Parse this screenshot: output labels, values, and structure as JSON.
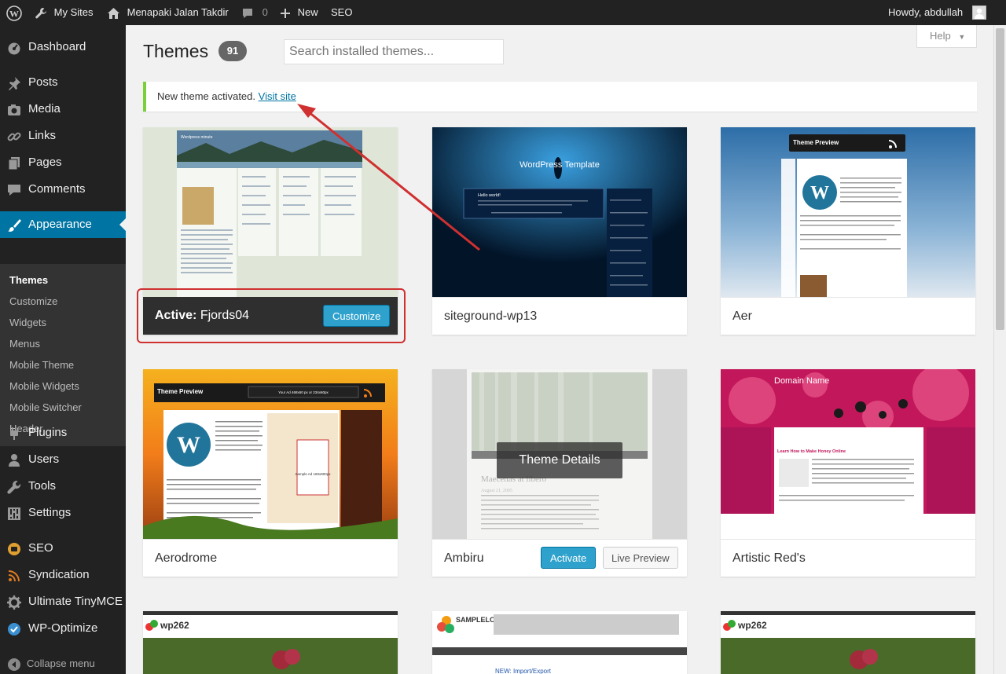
{
  "admin_bar": {
    "my_sites": "My Sites",
    "site_name": "Menapaki Jalan Takdir",
    "comments_count": "0",
    "new_label": "New",
    "seo_label": "SEO",
    "howdy": "Howdy, abdullah"
  },
  "menu": {
    "dashboard": "Dashboard",
    "posts": "Posts",
    "media": "Media",
    "links": "Links",
    "pages": "Pages",
    "comments": "Comments",
    "appearance": "Appearance",
    "plugins": "Plugins",
    "users": "Users",
    "tools": "Tools",
    "settings": "Settings",
    "seo": "SEO",
    "syndication": "Syndication",
    "ultimate_tinymce": "Ultimate TinyMCE",
    "wp_optimize": "WP-Optimize",
    "collapse": "Collapse menu"
  },
  "submenu": [
    "Themes",
    "Customize",
    "Widgets",
    "Menus",
    "Mobile Theme",
    "Mobile Widgets",
    "Mobile Switcher",
    "Header"
  ],
  "page": {
    "title": "Themes",
    "count": "91",
    "search_placeholder": "Search installed themes...",
    "help": "Help"
  },
  "notice": {
    "text": "New theme activated.",
    "link": "Visit site"
  },
  "themes": {
    "active_prefix": "Active:",
    "active_name": "Fjords04",
    "customize": "Customize",
    "t2": "siteground-wp13",
    "t3": "Aer",
    "t4": "Aerodrome",
    "t5": "Ambiru",
    "t6": "Artistic Red's",
    "activate": "Activate",
    "live_preview": "Live Preview",
    "theme_details": "Theme Details"
  },
  "screenshots": {
    "fjords_title": "Wordpress minute",
    "wp_template_title": "WordPress Template",
    "hello_world": "Hello world!",
    "theme_preview": "Theme Preview",
    "ad_text": "Your Ad 468x60 px or 234x60px",
    "sample_ad": "Sample Ad 180x800px",
    "ambiru_post": "Maecenas at libero",
    "ambiru_date": "August 21, 2005",
    "domain_name": "Domain Name",
    "honey": "Learn How to Make Honey Online",
    "wp262": "wp262",
    "samplelogo": "SAMPLELOGO",
    "new_import": "NEW: Import/Export"
  },
  "colors": {
    "admin_bar": "#222222",
    "sidebar": "#222222",
    "accent": "#0074a2",
    "button_blue": "#2ea2cc",
    "notice_green": "#7ad03a",
    "annotation_red": "#d03030"
  }
}
